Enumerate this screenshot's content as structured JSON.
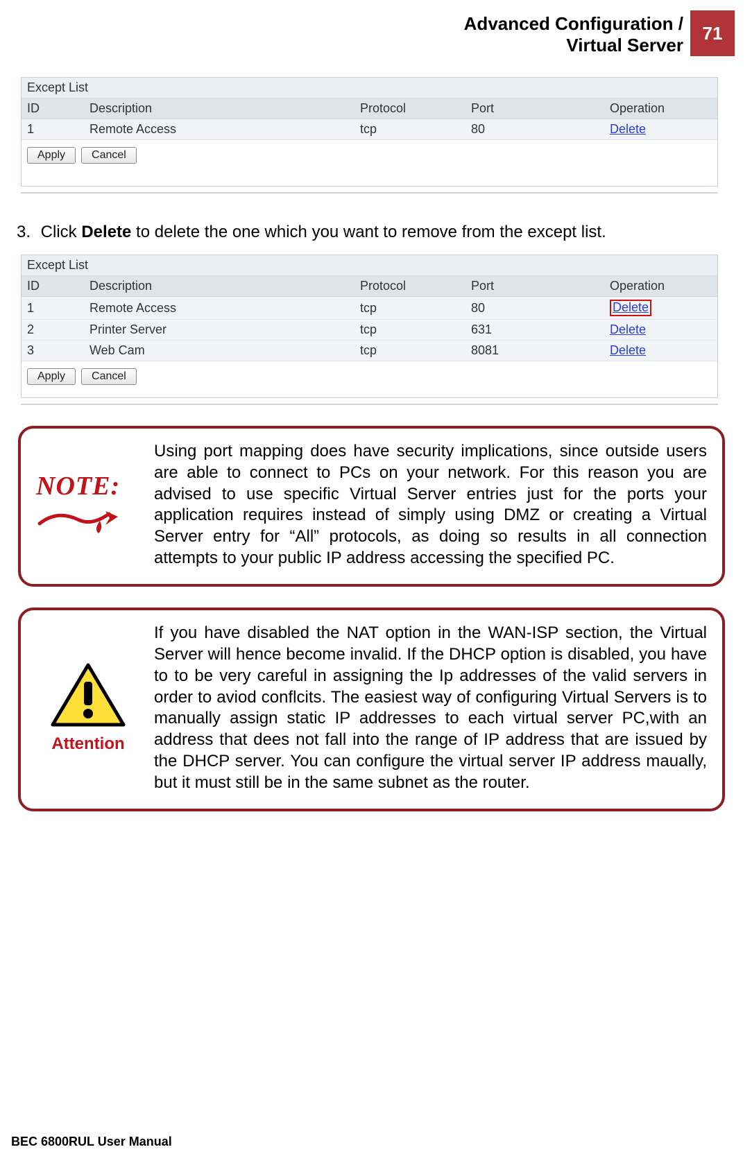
{
  "header": {
    "title_line1": "Advanced Configuration /",
    "title_line2": "Virtual Server",
    "page_number": "71"
  },
  "table1": {
    "title": "Except List",
    "headers": {
      "id": "ID",
      "desc": "Description",
      "proto": "Protocol",
      "port": "Port",
      "op": "Operation"
    },
    "rows": [
      {
        "id": "1",
        "desc": "Remote Access",
        "proto": "tcp",
        "port": "80",
        "op": "Delete"
      }
    ],
    "apply": "Apply",
    "cancel": "Cancel"
  },
  "step3": {
    "num": "3.",
    "prefix": "Click ",
    "bold": "Delete",
    "suffix": " to delete the one which you want to remove from the except list."
  },
  "table2": {
    "title": "Except List",
    "headers": {
      "id": "ID",
      "desc": "Description",
      "proto": "Protocol",
      "port": "Port",
      "op": "Operation"
    },
    "rows": [
      {
        "id": "1",
        "desc": "Remote Access",
        "proto": "tcp",
        "port": "80",
        "op": "Delete",
        "highlight": true
      },
      {
        "id": "2",
        "desc": "Printer Server",
        "proto": "tcp",
        "port": "631",
        "op": "Delete"
      },
      {
        "id": "3",
        "desc": "Web Cam",
        "proto": "tcp",
        "port": "8081",
        "op": "Delete"
      }
    ],
    "apply": "Apply",
    "cancel": "Cancel"
  },
  "note": {
    "label": "NOTE:",
    "text": "Using port mapping does have security implications, since outside users are able to connect to PCs on your network. For this reason you are advised to use specific Virtual Server entries just for the ports your application requires instead of simply using DMZ or creating a Virtual Server entry for “All” protocols, as doing so results in all connection attempts to your public IP address accessing the specified PC."
  },
  "attention": {
    "label": "Attention",
    "text": "If you have disabled the NAT option in the WAN-ISP section, the Virtual Server will hence become invalid. If the DHCP option is disabled, you have to to be very careful in assigning the Ip addresses of the valid servers in order to aviod conflcits. The easiest way of configuring Virtual Servers is to manually assign static IP addresses to each virtual server PC,with an address that dees not fall into the range of IP address that are issued by the DHCP server. You can configure the virtual server IP address maually, but it must still be in the same subnet as the router."
  },
  "footer": "BEC 6800RUL User Manual"
}
